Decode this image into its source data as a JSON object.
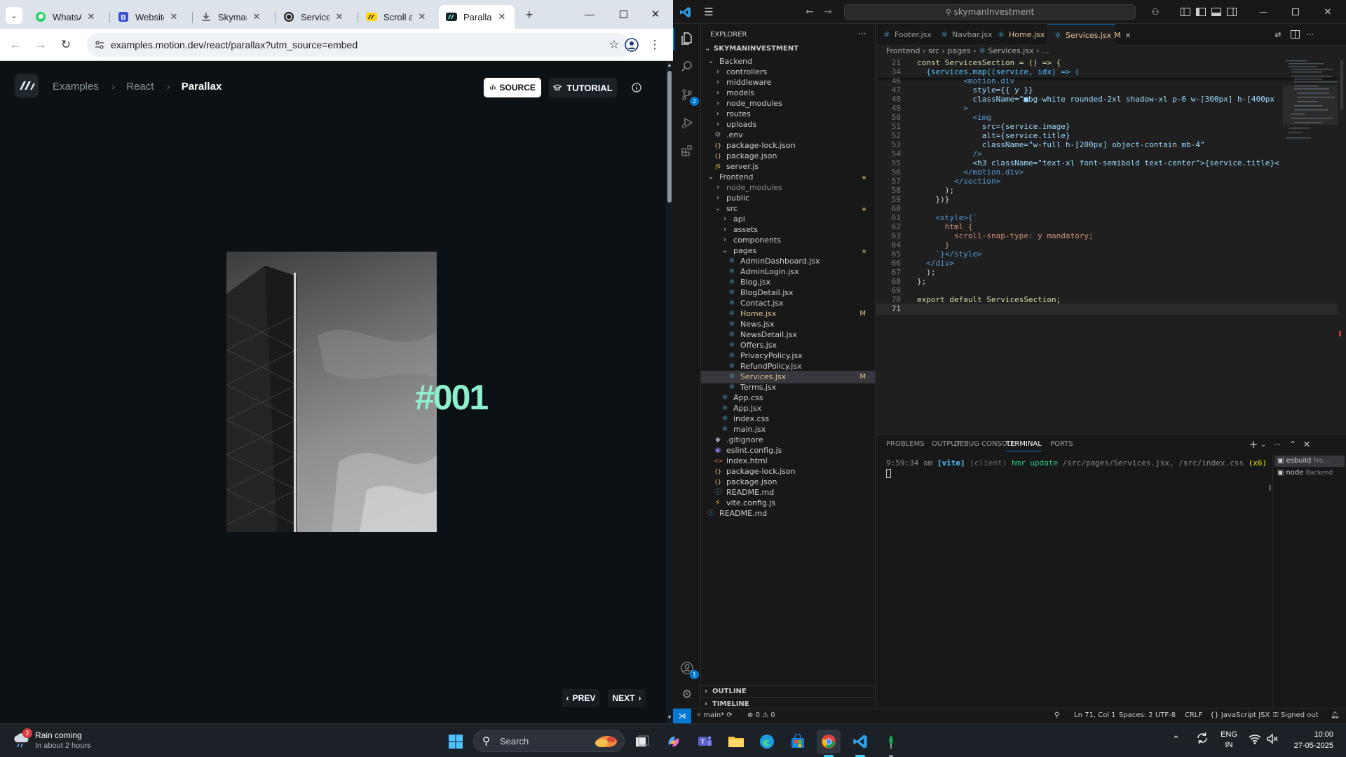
{
  "browser": {
    "tabs": [
      {
        "title": "WhatsApp",
        "icon": "whatsapp-icon"
      },
      {
        "title": "Website",
        "icon": "website-icon"
      },
      {
        "title": "Skyman",
        "icon": "download-icon"
      },
      {
        "title": "Services",
        "icon": "services-icon"
      },
      {
        "title": "Scroll ar",
        "icon": "motion-icon"
      },
      {
        "title": "Parallax",
        "icon": "motion-icon"
      }
    ],
    "url": "examples.motion.dev/react/parallax?utm_source=embed"
  },
  "page": {
    "breadcrumb": [
      "Examples",
      "React",
      "Parallax"
    ],
    "separator": "›",
    "source_label": "SOURCE",
    "tutorial_label": "TUTORIAL",
    "card_label": "#001",
    "prev_label": "PREV",
    "next_label": "NEXT",
    "accent_color": "#8df0cc"
  },
  "vscode": {
    "search_text": "skymanInvestment",
    "explorer_title": "EXPLORER",
    "project": "SKYMANINVESTMENT",
    "tree": [
      {
        "label": "Backend",
        "type": "folder-open",
        "depth": 0
      },
      {
        "label": "controllers",
        "type": "folder",
        "depth": 1
      },
      {
        "label": "middleware",
        "type": "folder",
        "depth": 1
      },
      {
        "label": "models",
        "type": "folder",
        "depth": 1
      },
      {
        "label": "node_modules",
        "type": "folder",
        "depth": 1
      },
      {
        "label": "routes",
        "type": "folder",
        "depth": 1
      },
      {
        "label": "uploads",
        "type": "folder",
        "depth": 1
      },
      {
        "label": ".env",
        "type": "gear",
        "depth": 1
      },
      {
        "label": "package-lock.json",
        "type": "json",
        "depth": 1
      },
      {
        "label": "package.json",
        "type": "json",
        "depth": 1
      },
      {
        "label": "server.js",
        "type": "js",
        "depth": 1
      },
      {
        "label": "Frontend",
        "type": "folder-open",
        "depth": 0,
        "dot": true
      },
      {
        "label": "node_modules",
        "type": "folder",
        "depth": 1,
        "dim": true
      },
      {
        "label": "public",
        "type": "folder",
        "depth": 1
      },
      {
        "label": "src",
        "type": "folder-open",
        "depth": 1,
        "dot": true
      },
      {
        "label": "api",
        "type": "folder",
        "depth": 2
      },
      {
        "label": "assets",
        "type": "folder",
        "depth": 2
      },
      {
        "label": "components",
        "type": "folder",
        "depth": 2
      },
      {
        "label": "pages",
        "type": "folder-open",
        "depth": 2,
        "dot": true
      },
      {
        "label": "AdminDashboard.jsx",
        "type": "react",
        "depth": 3
      },
      {
        "label": "AdminLogin.jsx",
        "type": "react",
        "depth": 3
      },
      {
        "label": "Blog.jsx",
        "type": "react",
        "depth": 3
      },
      {
        "label": "BlogDetail.jsx",
        "type": "react",
        "depth": 3
      },
      {
        "label": "Contact.jsx",
        "type": "react",
        "depth": 3
      },
      {
        "label": "Home.jsx",
        "type": "react",
        "depth": 3,
        "mod": "M"
      },
      {
        "label": "News.jsx",
        "type": "react",
        "depth": 3
      },
      {
        "label": "NewsDetail.jsx",
        "type": "react",
        "depth": 3
      },
      {
        "label": "Offers.jsx",
        "type": "react",
        "depth": 3
      },
      {
        "label": "PrivacyPolicy.jsx",
        "type": "react",
        "depth": 3
      },
      {
        "label": "RefundPolicy.jsx",
        "type": "react",
        "depth": 3
      },
      {
        "label": "Services.jsx",
        "type": "react",
        "depth": 3,
        "mod": "M",
        "selected": true
      },
      {
        "label": "Terms.jsx",
        "type": "react",
        "depth": 3
      },
      {
        "label": "App.css",
        "type": "css",
        "depth": 2
      },
      {
        "label": "App.jsx",
        "type": "react",
        "depth": 2
      },
      {
        "label": "index.css",
        "type": "css",
        "depth": 2
      },
      {
        "label": "main.jsx",
        "type": "react",
        "depth": 2
      },
      {
        "label": ".gitignore",
        "type": "git",
        "depth": 1
      },
      {
        "label": "eslint.config.js",
        "type": "eslint",
        "depth": 1
      },
      {
        "label": "index.html",
        "type": "html",
        "depth": 1
      },
      {
        "label": "package-lock.json",
        "type": "json",
        "depth": 1
      },
      {
        "label": "package.json",
        "type": "json",
        "depth": 1
      },
      {
        "label": "README.md",
        "type": "info",
        "depth": 1
      },
      {
        "label": "vite.config.js",
        "type": "vite",
        "depth": 1
      },
      {
        "label": "README.md",
        "type": "info",
        "depth": 0
      }
    ],
    "outline_label": "OUTLINE",
    "timeline_label": "TIMELINE",
    "editor_tabs": [
      {
        "label": "Footer.jsx",
        "mod": ""
      },
      {
        "label": "Navbar.jsx",
        "mod": ""
      },
      {
        "label": "Home.jsx",
        "mod": "M"
      },
      {
        "label": "Services.jsx",
        "mod": "M",
        "active": true
      }
    ],
    "breadcrumbs": [
      "Frontend",
      "src",
      "pages",
      "Services.jsx",
      "..."
    ],
    "code_lines": [
      {
        "n": "21",
        "t": "const ServicesSection = () => {"
      },
      {
        "n": "34",
        "t": "  {services.map((service, idx) => ("
      },
      {
        "n": "46",
        "t": "          <motion.div"
      },
      {
        "n": "47",
        "t": "            style={{ y }}"
      },
      {
        "n": "48",
        "t": "            className=\"■bg-white rounded-2xl shadow-xl p-6 w-[300px] h-[400px"
      },
      {
        "n": "49",
        "t": "          >"
      },
      {
        "n": "50",
        "t": "            <img"
      },
      {
        "n": "51",
        "t": "              src={service.image}"
      },
      {
        "n": "52",
        "t": "              alt={service.title}"
      },
      {
        "n": "53",
        "t": "              className=\"w-full h-[200px] object-contain mb-4\""
      },
      {
        "n": "54",
        "t": "            />"
      },
      {
        "n": "55",
        "t": "            <h3 className=\"text-xl font-semibold text-center\">{service.title}<"
      },
      {
        "n": "56",
        "t": "          </motion.div>"
      },
      {
        "n": "57",
        "t": "        </section>"
      },
      {
        "n": "58",
        "t": "      );"
      },
      {
        "n": "59",
        "t": "    })}"
      },
      {
        "n": "60",
        "t": ""
      },
      {
        "n": "61",
        "t": "    <style>{`"
      },
      {
        "n": "62",
        "t": "      html {"
      },
      {
        "n": "63",
        "t": "        scroll-snap-type: y mandatory;"
      },
      {
        "n": "64",
        "t": "      }"
      },
      {
        "n": "65",
        "t": "    `}</style>"
      },
      {
        "n": "66",
        "t": "  </div>"
      },
      {
        "n": "67",
        "t": "  );"
      },
      {
        "n": "68",
        "t": "};"
      },
      {
        "n": "69",
        "t": ""
      },
      {
        "n": "70",
        "t": "export default ServicesSection;"
      },
      {
        "n": "71",
        "t": ""
      }
    ],
    "panel_tabs": [
      "PROBLEMS",
      "OUTPUT",
      "DEBUG CONSOLE",
      "TERMINAL",
      "PORTS"
    ],
    "active_panel_tab": "TERMINAL",
    "terminal": {
      "time": "9:59:34 am",
      "tag": "[vite]",
      "client": "(client)",
      "msg": "hmr update",
      "paths": "/src/pages/Services.jsx, /src/index.css",
      "count": "(x6)"
    },
    "terminals": [
      {
        "label": "esbuild",
        "sub": "Fro..."
      },
      {
        "label": "node",
        "sub": "Backend"
      }
    ],
    "status": {
      "branch": "main*",
      "errors": "0",
      "warnings": "0",
      "position": "Ln 71, Col 1",
      "spaces": "Spaces: 2",
      "encoding": "UTF-8",
      "eol": "CRLF",
      "language": "JavaScript JSX",
      "account": "Signed out"
    },
    "accounts_badge": "1",
    "scm_badge": "2"
  },
  "taskbar": {
    "weather_title": "Rain coming",
    "weather_sub": "In about 2 hours",
    "weather_badge": "2",
    "search_placeholder": "Search",
    "lang": "ENG",
    "region": "IN",
    "time": "10:00",
    "date": "27-05-2025"
  }
}
